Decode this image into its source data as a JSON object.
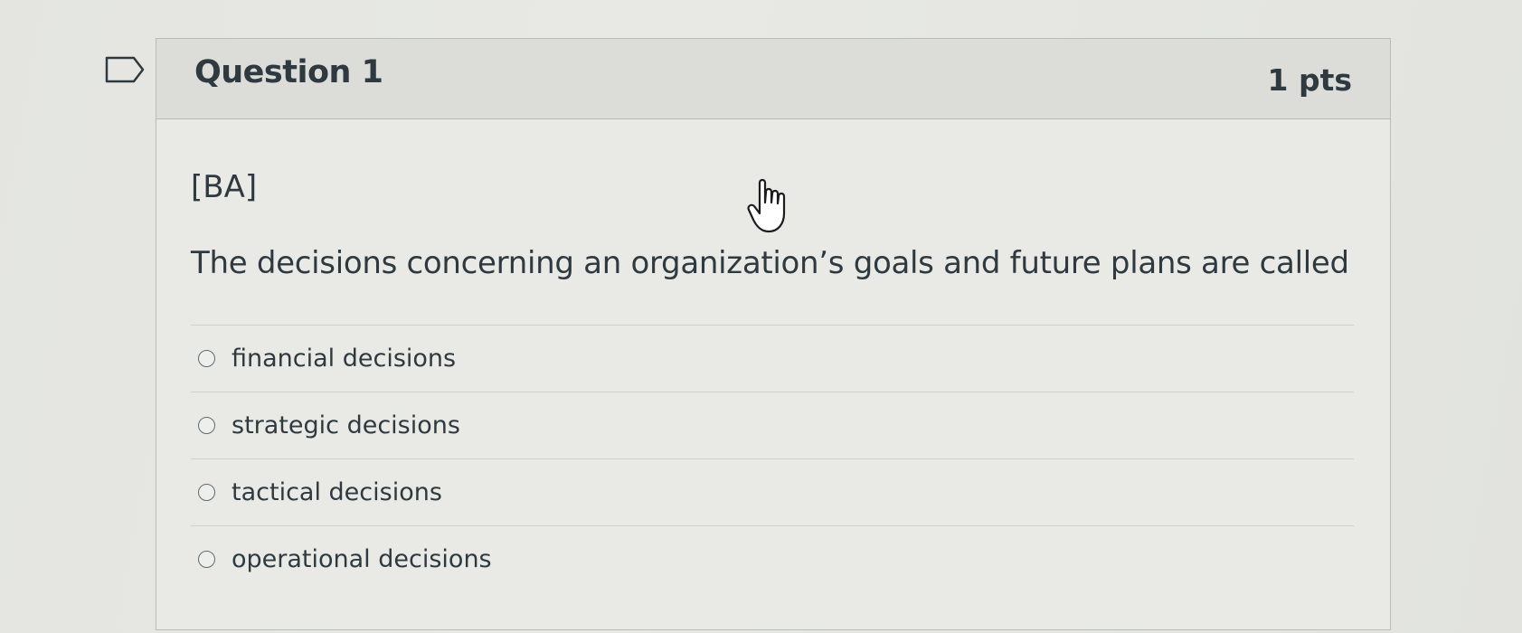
{
  "question": {
    "title": "Question 1",
    "points": "1 pts",
    "tag": "[BA]",
    "text": "The decisions concerning an organization’s goals and future plans are called"
  },
  "answers": [
    {
      "label": "financial decisions"
    },
    {
      "label": "strategic decisions"
    },
    {
      "label": "tactical decisions"
    },
    {
      "label": "operational decisions"
    }
  ],
  "icons": {
    "flag": "flag-question-icon",
    "cursor": "hand-pointer-icon"
  },
  "colors": {
    "page_background": "#e6e7e3",
    "card_header": "#dcddd9",
    "text": "#2f3a40",
    "border": "#b9bcb8"
  }
}
